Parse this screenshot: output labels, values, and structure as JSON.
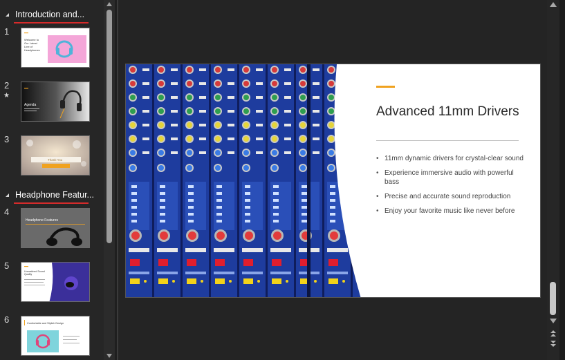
{
  "sections": [
    {
      "title": "Introduction and..."
    },
    {
      "title": "Headphone Featur..."
    }
  ],
  "slides": [
    {
      "number": "1",
      "text_lines": [
        "Welcome to",
        "Our Latest",
        "Line of",
        "Headphones"
      ]
    },
    {
      "number": "2",
      "star": "★",
      "text": "Agenda"
    },
    {
      "number": "3",
      "text": "Thank You"
    },
    {
      "number": "4",
      "text": "Headphone Features"
    },
    {
      "number": "5",
      "text_lines": [
        "Unmatched Sound",
        "Quality"
      ]
    },
    {
      "number": "6",
      "text": "Comfortable and Stylish Design"
    }
  ],
  "current_slide": {
    "title": "Advanced 11mm Drivers",
    "bullets": [
      "11mm dynamic drivers for crystal-clear sound",
      "Experience immersive audio with powerful bass",
      "Precise and accurate sound reproduction",
      "Enjoy your favorite music like never before"
    ]
  },
  "icons": {
    "pane_scroll_up": "chevron-up-icon",
    "pane_scroll_down": "chevron-down-icon",
    "main_scroll_up": "chevron-up-icon",
    "main_scroll_down": "chevron-down-icon",
    "prev_slide": "double-chevron-up-icon",
    "next_slide": "double-chevron-down-icon"
  },
  "colors": {
    "accent": "#f0a21f",
    "section_underline": "#d62b2b",
    "mixer_blue": "#1e3c9e"
  }
}
